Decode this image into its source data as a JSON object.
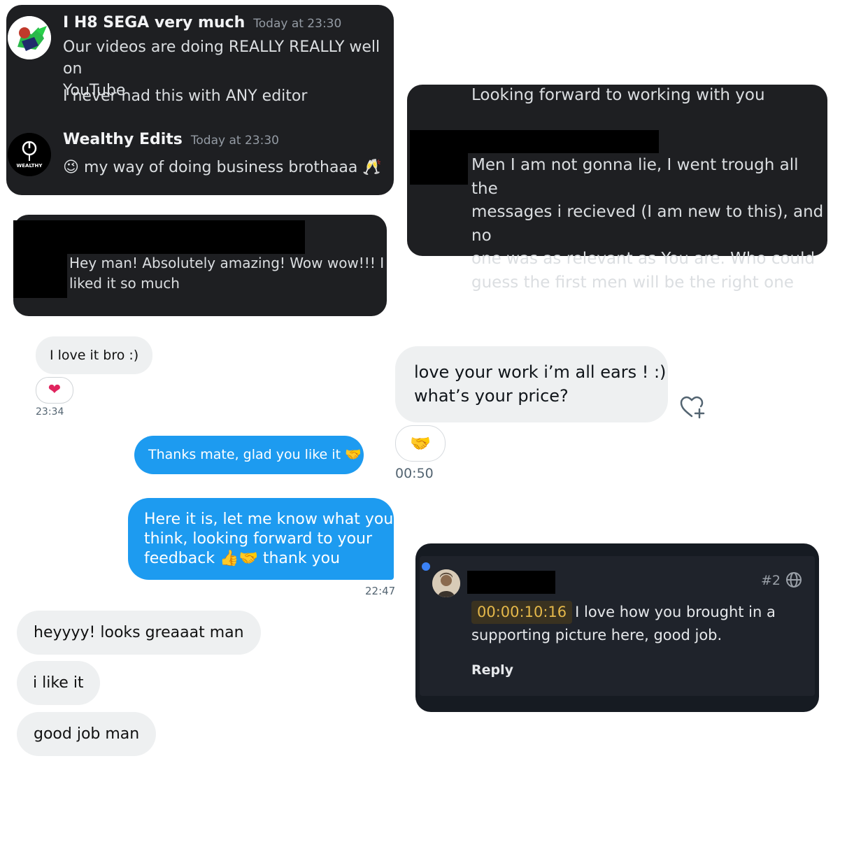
{
  "discord_card": {
    "user1": {
      "name": "I H8 SEGA very much",
      "timestamp": "Today at 23:30"
    },
    "msg1_line1": "Our videos are doing REALLY REALLY well on",
    "msg1_line2": "YouTube",
    "msg2": "I never had this with ANY editor",
    "user2": {
      "name": "Wealthy Edits",
      "timestamp": "Today at 23:30",
      "avatar_text": "WEALTHY"
    },
    "msg3": "my way of doing business brothaaa",
    "msg3_emoji_left": "😉",
    "msg3_emoji_right": "🥂"
  },
  "dark_card_2": {
    "msg_line1": "Hey man! Absolutely amazing! Wow wow!!! I",
    "msg_line2": "liked it so much"
  },
  "dark_card_3": {
    "msg_top": "Looking forward to working with you",
    "msg_lines": [
      "Men I am not gonna lie, I went trough all the",
      "messages i recieved (I am new to this), and no",
      "one was as relevant as You are. Who could",
      "guess the first men will be the right one"
    ]
  },
  "chat_a": {
    "bubble": "I love it bro :)",
    "reaction": "❤",
    "time": "23:34"
  },
  "chat_b": {
    "line1": "love your work i’m all ears ! :)",
    "line2": "what’s your price?",
    "reaction": "🤝",
    "time": "00:50",
    "react_icon": "heart-plus-icon"
  },
  "chat_c": {
    "bubble": "Thanks mate, glad you like it",
    "emoji": "🤝"
  },
  "chat_d": {
    "line1": "Here it is, let me know what you",
    "line2": "think, looking forward to your",
    "line3_a": "feedback",
    "line3_emoji": "👍🤝",
    "line3_b": "thank you",
    "time": "22:47"
  },
  "chat_e": {
    "bubbles": [
      "heyyyy! looks greaaat man",
      "i like it",
      "good job man"
    ]
  },
  "review_card": {
    "index": "#2",
    "timecode": "00:00:10:16",
    "comment_line1": "I love how you brought in a",
    "comment_line2": "supporting picture here, good job.",
    "reply": "Reply",
    "accent_dot": "#3b82f6",
    "timecode_color": "#e5b84a",
    "icon": "globe-icon"
  }
}
